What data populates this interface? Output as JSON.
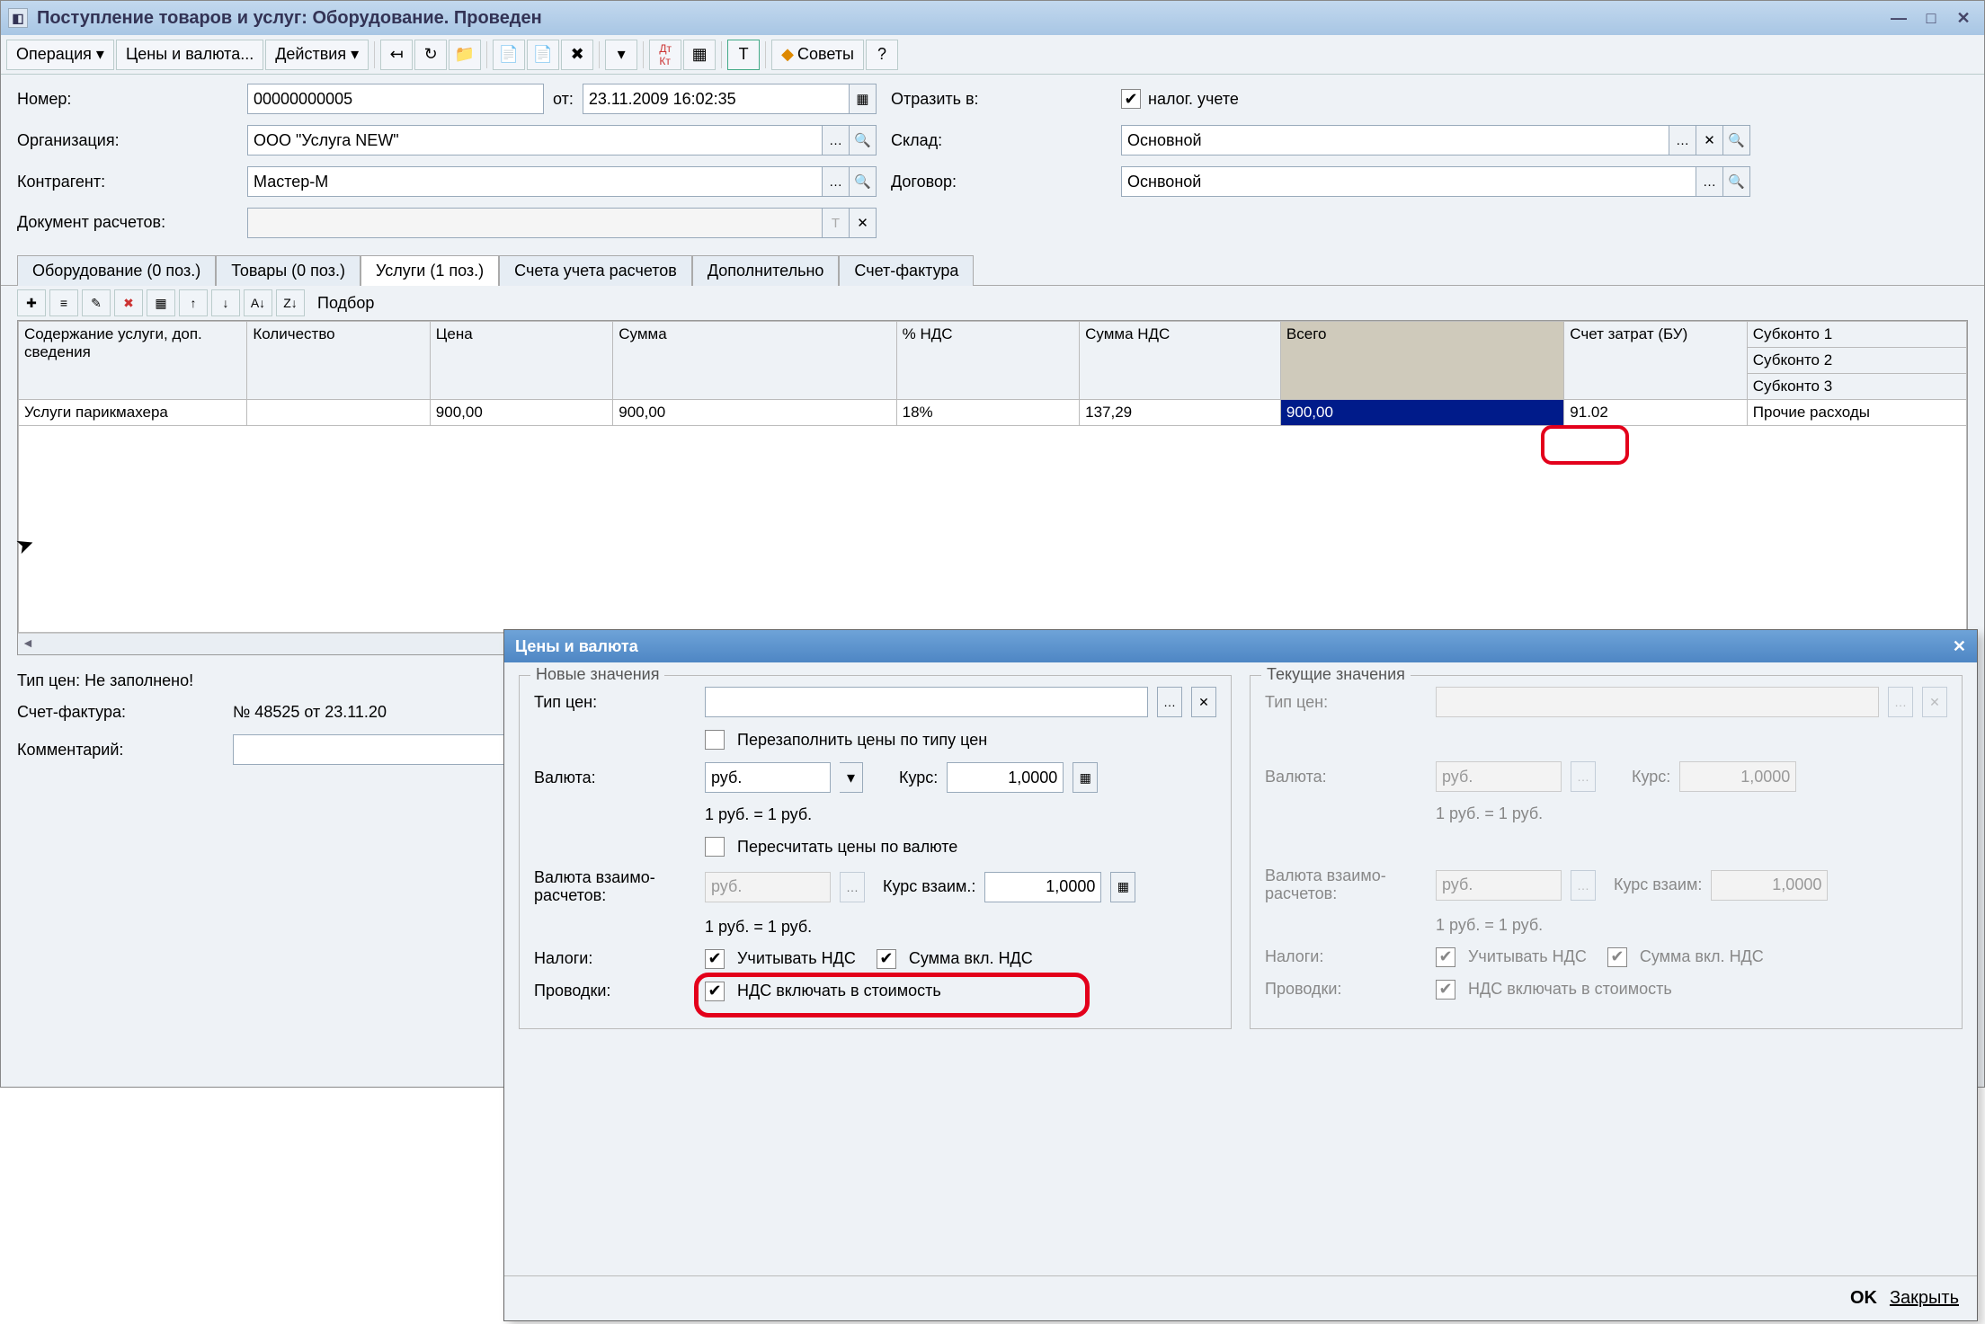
{
  "window": {
    "title": "Поступление товаров и услуг: Оборудование. Проведен"
  },
  "toolbar": {
    "operation": "Операция ▾",
    "prices": "Цены и валюта...",
    "actions": "Действия ▾",
    "advice": "Советы"
  },
  "form": {
    "number_label": "Номер:",
    "number": "00000000005",
    "from_label": "от:",
    "from_date": "23.11.2009 16:02:35",
    "reflect_label": "Отразить в:",
    "reflect_check": "налог. учете",
    "org_label": "Организация:",
    "org": "ООО \"Услуга NEW\"",
    "sklad_label": "Склад:",
    "sklad": "Основной",
    "contr_label": "Контрагент:",
    "contr": "Мастер-М",
    "dogovor_label": "Договор:",
    "dogovor": "Оснвоной",
    "docras_label": "Документ расчетов:"
  },
  "tabs": [
    "Оборудование (0 поз.)",
    "Товары (0 поз.)",
    "Услуги (1 поз.)",
    "Счета учета расчетов",
    "Дополнительно",
    "Счет-фактура"
  ],
  "grid": {
    "podbor": "Подбор",
    "headers": [
      "Содержание услуги, доп. сведения",
      "Количество",
      "Цена",
      "Сумма",
      "% НДС",
      "Сумма НДС",
      "Всего",
      "Счет затрат (БУ)",
      "Субконто 1",
      "Субконто 2",
      "Субконто 3"
    ],
    "row": {
      "service": "Услуги парикмахера",
      "qty": "",
      "price": "900,00",
      "sum": "900,00",
      "vatp": "18%",
      "vatsum": "137,29",
      "total": "900,00",
      "acct": "91.02",
      "sub1": "Прочие расходы"
    }
  },
  "bottom": {
    "tip_label": "Тип цен: Не заполнено!",
    "sf_label": "Счет-фактура:",
    "sf_value": "№ 48525 от 23.11.20",
    "comment_label": "Комментарий:"
  },
  "modal": {
    "title": "Цены и валюта",
    "new_legend": "Новые значения",
    "cur_legend": "Текущие значения",
    "tip_label": "Тип цен:",
    "refill": "Перезаполнить цены по типу цен",
    "valuta_label": "Валюта:",
    "valuta": "руб.",
    "kurs_label": "Курс:",
    "kurs": "1,0000",
    "rate_text": "1 руб. = 1 руб.",
    "recalc": "Пересчитать цены по валюте",
    "vzaim_label": "Валюта взаимо-расчетов:",
    "vzaim_val": "руб.",
    "kurs_vz_label": "Курс взаим.:",
    "kurs_vz": "1,0000",
    "tax_label": "Налоги:",
    "tax1": "Учитывать НДС",
    "tax2": "Сумма вкл. НДС",
    "prov_label": "Проводки:",
    "prov": "НДС включать в стоимость",
    "kurs_vz_label_r": "Курс взаим:",
    "ok": "OK",
    "close": "Закрыть"
  }
}
